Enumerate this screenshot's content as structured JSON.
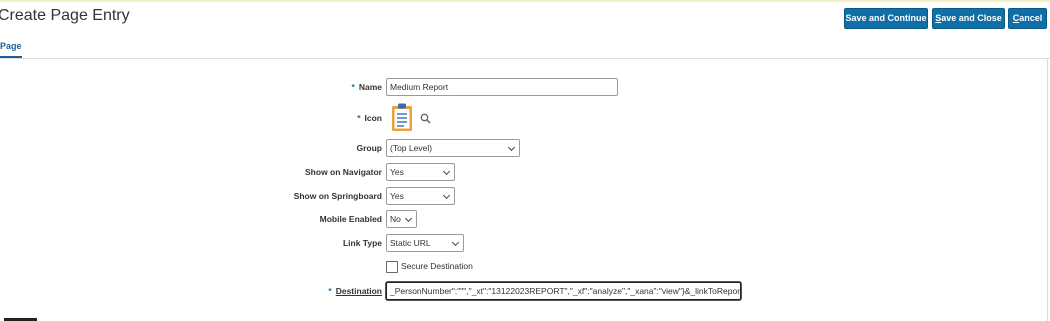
{
  "page": {
    "title": "Create Page Entry"
  },
  "toolbar": {
    "save_continue": "Save and Continue",
    "save_close": {
      "prefix": "S",
      "rest": "ave and Close"
    },
    "cancel": {
      "prefix": "C",
      "rest": "ancel"
    }
  },
  "tabs": [
    {
      "label": "Page",
      "active": true
    }
  ],
  "form": {
    "required_marker": "*",
    "name": {
      "label": "Name",
      "value": "Medium Report",
      "required": true
    },
    "icon": {
      "label": "Icon",
      "required": true,
      "icon": "clipboard-icon",
      "search_icon": "search-icon"
    },
    "group": {
      "label": "Group",
      "value": "(Top Level)"
    },
    "show_navigator": {
      "label": "Show on Navigator",
      "value": "Yes"
    },
    "show_springboard": {
      "label": "Show on Springboard",
      "value": "Yes"
    },
    "mobile_enabled": {
      "label": "Mobile Enabled",
      "value": "No"
    },
    "link_type": {
      "label": "Link Type",
      "value": "Static URL"
    },
    "secure_destination": {
      "label": "Secure Destination",
      "checked": false
    },
    "destination": {
      "label": "Destination",
      "required": true,
      "value": "_PersonNumber\":\"\"\",\"_xt\":\"13122023REPORT\",\"_xf\":\"analyze\",\"_xana\":\"view\"}&_linkToReport=true"
    }
  },
  "colors": {
    "accent": "#0f6fa6",
    "tab": "#1f5f99",
    "icon_orange": "#e8a33d",
    "icon_blue": "#2f6db5"
  }
}
